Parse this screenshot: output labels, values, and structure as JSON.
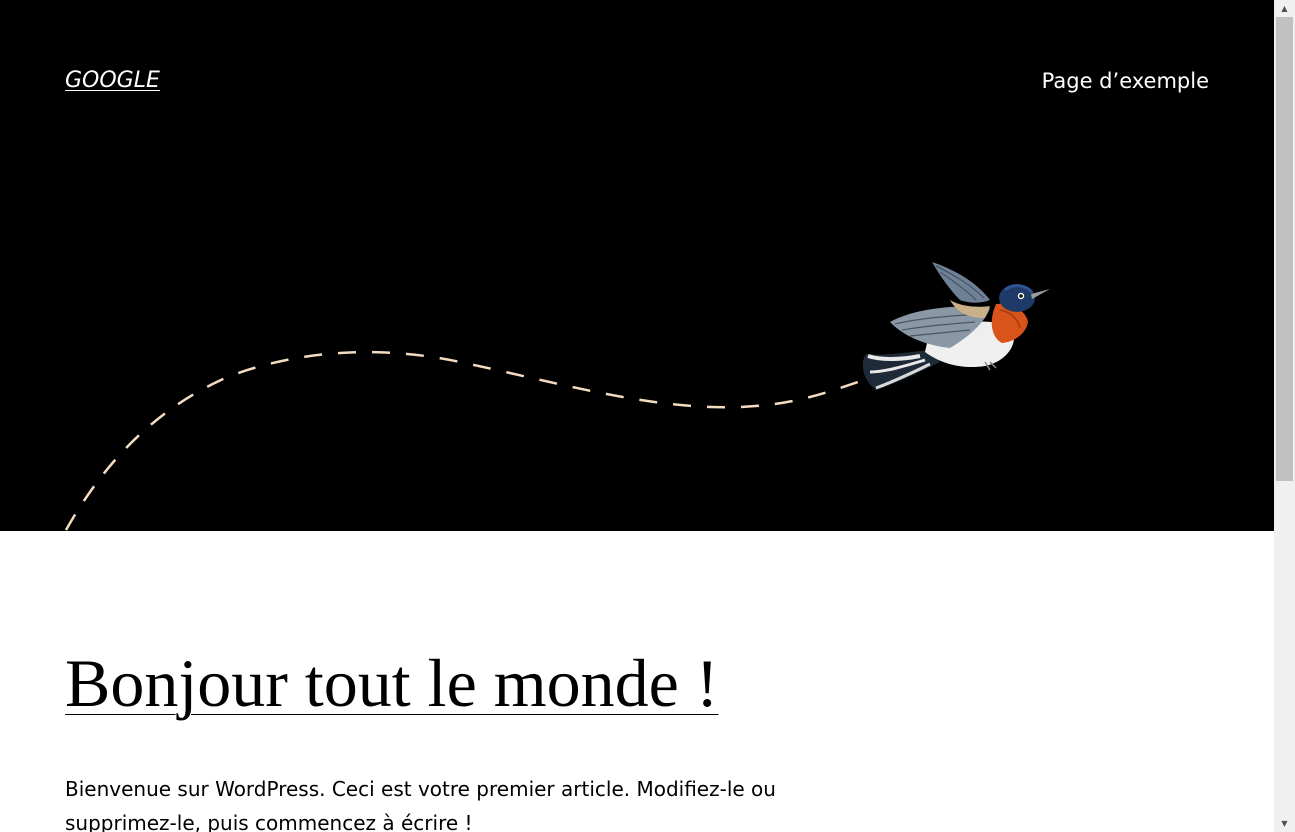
{
  "header": {
    "site_title": "GOOGLE",
    "nav_items": [
      {
        "label": "Page d’exemple"
      }
    ]
  },
  "hero": {
    "background_color": "#000000",
    "path_color": "#f5dcc0",
    "image": "hummingbird-illustration"
  },
  "post": {
    "title": "Bonjour tout le monde !",
    "excerpt": "Bienvenue sur WordPress. Ceci est votre premier article. Modifiez-le ou supprimez-le, puis commencez à écrire !"
  },
  "scrollbar": {
    "up_arrow": "▲",
    "down_arrow": "▼"
  }
}
